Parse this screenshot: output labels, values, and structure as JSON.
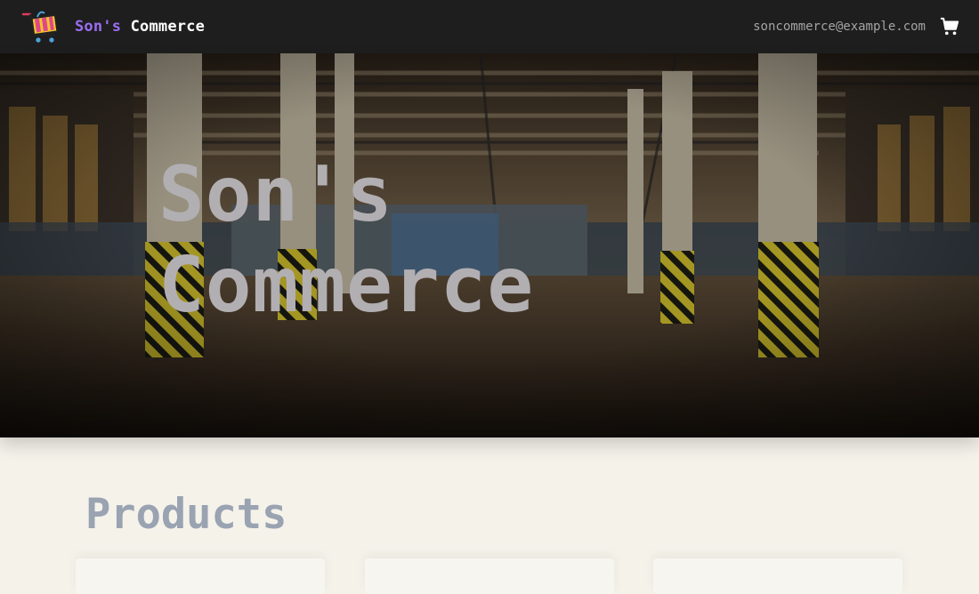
{
  "navbar": {
    "brand_part1": "Son's",
    "brand_part2": "Commerce",
    "email": "soncommerce@example.com",
    "cart_icon": "shopping-cart-icon",
    "logo_icon": "shopping-cart-logo-icon"
  },
  "hero": {
    "title": "Son's\nCommerce"
  },
  "products": {
    "heading": "Products"
  },
  "colors": {
    "navbar_bg": "#1e1e1e",
    "brand_accent": "#9b6ef3",
    "page_bg": "#f5f2ea",
    "heading": "#9aa3b1"
  }
}
